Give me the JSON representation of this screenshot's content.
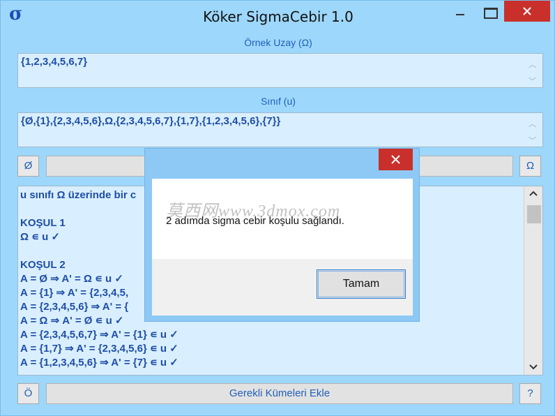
{
  "app": {
    "icon_glyph": "σ",
    "title": "Köker SigmaCebir 1.0"
  },
  "sample_space": {
    "label": "Örnek Uzay (Ω)",
    "value": "{1,2,3,4,5,6,7}"
  },
  "class_field": {
    "label": "Sınıf (u)",
    "value": "{Ø,{1},{2,3,4,5,6},Ω,{2,3,4,5,6,7},{1,7},{1,2,3,4,5,6},{7}}"
  },
  "toolbar_top": {
    "empty_set_label": "Ø",
    "omega_label": "Ω"
  },
  "log": {
    "lines": [
      "u sınıfı Ω üzerinde bir c",
      "",
      "KOŞUL 1",
      "Ω ∊ u ✓",
      "",
      "KOŞUL 2",
      "A = Ø ⇒ A' = Ω ∊ u ✓",
      "A = {1} ⇒ A' = {2,3,4,5,",
      "A = {2,3,4,5,6} ⇒ A' = {",
      "A = Ω ⇒ A' = Ø ∊ u ✓",
      "A = {2,3,4,5,6,7} ⇒ A' = {1} ∊ u ✓",
      "A = {1,7} ⇒ A' = {2,3,4,5,6} ∊ u ✓",
      "A = {1,2,3,4,5,6} ⇒ A' = {7} ∊ u ✓"
    ]
  },
  "toolbar_bottom": {
    "o_label": "Ö",
    "add_label": "Gerekli Kümeleri Ekle",
    "help_label": "?"
  },
  "dialog": {
    "watermark": "莫西网www.3dmox.com",
    "message": "2 adımda sigma cebir koşulu sağlandı.",
    "ok_label": "Tamam"
  },
  "colors": {
    "window_bg": "#9dd7fb",
    "field_bg": "#d9efff",
    "text_blue": "#1f4ea6",
    "close_red": "#c9302c"
  }
}
